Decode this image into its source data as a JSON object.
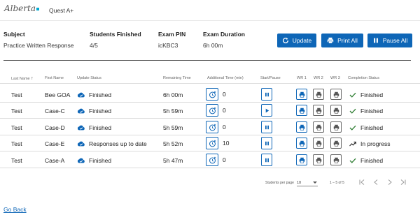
{
  "header": {
    "logo_text": "Alberta",
    "app_title": "Quest A+"
  },
  "summary": {
    "subject": {
      "label": "Subject",
      "value": "Practice Written Response"
    },
    "students_finished": {
      "label": "Students Finished",
      "value": "4/5"
    },
    "exam_pin": {
      "label": "Exam PIN",
      "value": "icKBC3"
    },
    "exam_duration": {
      "label": "Exam Duration",
      "value": "6h 00m"
    }
  },
  "actions": {
    "update": "Update",
    "print_all": "Print All",
    "pause_all": "Pause All"
  },
  "table": {
    "headers": {
      "last_name": "Last Name",
      "first_name": "First Name",
      "update_status": "Update Status",
      "remaining_time": "Remaining Time",
      "additional_time": "Additional Time (min)",
      "start_pause": "Start/Pause",
      "wr1": "WR 1",
      "wr2": "WR 2",
      "wr3": "WR 3",
      "completion_status": "Completion Status"
    },
    "rows": [
      {
        "last_name": "Test",
        "first_name": "Bee GOA",
        "update_status": "Finished",
        "remaining_time": "6h 00m",
        "additional_time": "0",
        "control": "pause",
        "completion": "Finished",
        "completion_icon": "check-icon"
      },
      {
        "last_name": "Test",
        "first_name": "Case-C",
        "update_status": "Finished",
        "remaining_time": "5h 59m",
        "additional_time": "0",
        "control": "play",
        "completion": "Finished",
        "completion_icon": "check-icon"
      },
      {
        "last_name": "Test",
        "first_name": "Case-D",
        "update_status": "Finished",
        "remaining_time": "5h 59m",
        "additional_time": "0",
        "control": "pause",
        "completion": "Finished",
        "completion_icon": "check-icon"
      },
      {
        "last_name": "Test",
        "first_name": "Case-E",
        "update_status": "Responses up to date",
        "remaining_time": "5h 52m",
        "additional_time": "10",
        "control": "pause",
        "completion": "In progress",
        "completion_icon": "trending-up-icon"
      },
      {
        "last_name": "Test",
        "first_name": "Case-A",
        "update_status": "Finished",
        "remaining_time": "5h 47m",
        "additional_time": "0",
        "control": "pause",
        "completion": "Finished",
        "completion_icon": "check-icon"
      }
    ]
  },
  "pagination": {
    "per_page_label": "Students per page",
    "per_page_value": "10",
    "range": "1 – 5 of 5"
  },
  "footer": {
    "go_back": "Go Back"
  },
  "colors": {
    "accent": "#0e66b7",
    "divider": "#555555"
  }
}
